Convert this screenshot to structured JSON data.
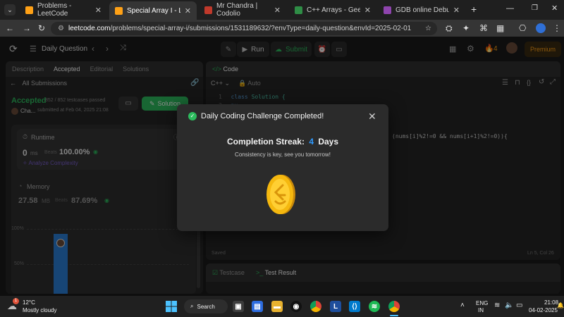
{
  "browser": {
    "tabs": [
      {
        "label": "Problems - LeetCode",
        "active": false
      },
      {
        "label": "Special Array I - LeetCode",
        "active": true
      },
      {
        "label": "Mr Chandra | Codolio",
        "active": false
      },
      {
        "label": "C++ Arrays - GeeksforGe",
        "active": false
      },
      {
        "label": "GDB online Debugger | C",
        "active": false
      }
    ],
    "url_domain": "leetcode.com",
    "url_path": "/problems/special-array-i/submissions/1531189632/?envType=daily-question&envId=2025-02-01"
  },
  "header": {
    "title": "Daily Question",
    "run_label": "Run",
    "submit_label": "Submit",
    "streak_count": "4",
    "premium_label": "Premium"
  },
  "left_panel": {
    "tabs": [
      "Description",
      "Accepted",
      "Editorial",
      "Solutions"
    ],
    "all_submissions": "All Submissions",
    "status": "Accepted",
    "testcases": "852 / 852 testcases passed",
    "user": "Cha...",
    "submitted": "submitted at Feb 04, 2025 21:08",
    "solution_label": "Solution",
    "runtime_title": "Runtime",
    "runtime_value": "0",
    "runtime_unit": "ms",
    "beats_label": "Beats",
    "runtime_beats": "100.00%",
    "analyze": "Analyze Complexity",
    "memory_title": "Memory",
    "memory_value": "27.58",
    "memory_unit": "MB",
    "memory_beats": "87.69%",
    "graph_ticks": [
      "100%",
      "50%"
    ],
    "bar_fraction": 0.92
  },
  "code_panel": {
    "title": "Code",
    "language": "C++",
    "mode": "Auto",
    "lines": [
      {
        "num": "1",
        "kw": "class",
        "rest": " Solution {"
      },
      {
        "num": "2",
        "kw": "",
        "rest": "pu"
      }
    ],
    "fragment": "(nums[i]%2!=0 && nums[i+1]%2!=0)){",
    "saved": "Saved",
    "cursor": "Ln 5, Col 26"
  },
  "bottom_panel": {
    "testcase": "Testcase",
    "result": "Test Result"
  },
  "modal": {
    "title": "Daily Coding Challenge Completed!",
    "streak_label": "Completion Streak:",
    "streak_number": "4",
    "streak_unit": "Days",
    "subtitle": "Consistency is key, see you tomorrow!"
  },
  "taskbar": {
    "temperature": "12°C",
    "weather": "Mostly cloudy",
    "search": "Search",
    "lang_1": "ENG",
    "lang_2": "IN",
    "time": "21:08",
    "date": "04-02-2025",
    "notif_count": "1"
  },
  "colors": {
    "accepted": "#2cbb5d",
    "leetcode_orange": "#ffa116",
    "streak_blue": "#2f9bff",
    "premium": "#ffa116"
  }
}
